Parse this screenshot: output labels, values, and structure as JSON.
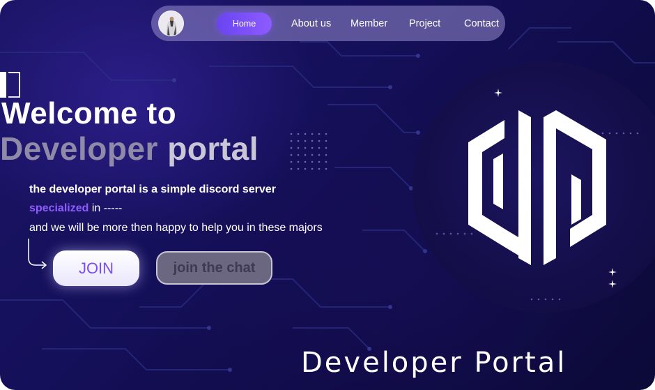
{
  "nav": {
    "avatar_icon": "user-avatar-icon",
    "home": "Home",
    "about": "About us",
    "member": "Member",
    "project": "Project",
    "contact": "Contact"
  },
  "hero": {
    "title_line1": "Welcome to",
    "title_line2_part1": "Developer",
    "title_line2_part2": "portal",
    "desc_line1": "the developer portal is a simple  discord server",
    "desc_line2_highlight": "specialized",
    "desc_line2_rest": " in  -----",
    "desc_line3": "and we will be  more then happy to help you in these majors"
  },
  "buttons": {
    "join": "JOIN",
    "chat": "join the chat"
  },
  "logo": {
    "icon": "developer-portal-logo-icon"
  },
  "footer": {
    "title": "Developer Portal"
  },
  "colors": {
    "accent": "#7b4fe6",
    "nav_active": "#6a44f0",
    "background": "#15105a"
  }
}
